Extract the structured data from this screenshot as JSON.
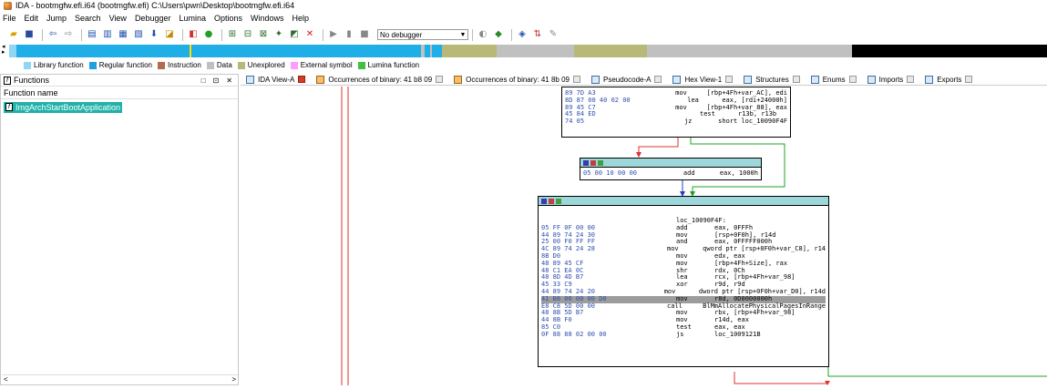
{
  "title": "IDA - bootmgfw.efi.i64 (bootmgfw.efi) C:\\Users\\pwn\\Desktop\\bootmgfw.efi.i64",
  "menu": [
    "File",
    "Edit",
    "Jump",
    "Search",
    "View",
    "Debugger",
    "Lumina",
    "Options",
    "Windows",
    "Help"
  ],
  "toolbar": {
    "debugger_select": "No debugger"
  },
  "legend": [
    {
      "label": "Library function",
      "color": "#8fd5f5"
    },
    {
      "label": "Regular function",
      "color": "#1fa0e0"
    },
    {
      "label": "Instruction",
      "color": "#b06c4c"
    },
    {
      "label": "Data",
      "color": "#c0c0c0"
    },
    {
      "label": "Unexplored",
      "color": "#b8b878"
    },
    {
      "label": "External symbol",
      "color": "#ff9cff"
    },
    {
      "label": "Lumina function",
      "color": "#40c040"
    }
  ],
  "functions_panel": {
    "title": "Functions",
    "column_header": "Function name",
    "items": [
      "ImgArchStartBootApplication"
    ]
  },
  "tabs": [
    {
      "label": "IDA View-A",
      "active": true
    },
    {
      "label": "Occurrences of binary: 41 b8 09",
      "active": false
    },
    {
      "label": "Occurrences of binary: 41 8b 09",
      "active": false
    },
    {
      "label": "Pseudocode-A",
      "active": false
    },
    {
      "label": "Hex View-1",
      "active": false
    },
    {
      "label": "Structures",
      "active": false
    },
    {
      "label": "Enums",
      "active": false
    },
    {
      "label": "Imports",
      "active": false
    },
    {
      "label": "Exports",
      "active": false
    }
  ],
  "graph": {
    "block1": {
      "lines": [
        {
          "b": "89 7D A3",
          "m": "mov",
          "o": "[rbp+4Fh+var_AC], edi"
        },
        {
          "b": "8D 87 00 40 02 00",
          "m": "lea",
          "o": "eax, [rdi+24000h]"
        },
        {
          "b": "89 45 C7",
          "m": "mov",
          "o": "[rbp+4Fh+var_88], eax"
        },
        {
          "b": "45 84 ED",
          "m": "test",
          "o": "r13b, r13b"
        },
        {
          "b": "74 05",
          "m": "jz",
          "o": "short loc_10090F4F"
        }
      ]
    },
    "block2": {
      "lines": [
        {
          "b": "05 00 10 00 00",
          "m": "add",
          "o": "eax, 1000h"
        }
      ]
    },
    "block3": {
      "label": "loc_10090F4F:",
      "lines": [
        {
          "b": "05 FF 0F 00 00",
          "m": "add",
          "o": "eax, 0FFFh"
        },
        {
          "b": "44 89 74 24 30",
          "m": "mov",
          "o": "[rsp+0F0h], r14d"
        },
        {
          "b": "25 00 F0 FF FF",
          "m": "and",
          "o": "eax, 0FFFFF000h"
        },
        {
          "b": "4C 89 74 24 28",
          "m": "mov",
          "o": "qword ptr [rsp+0F0h+var_C8], r14"
        },
        {
          "b": "8B D0",
          "m": "mov",
          "o": "edx, eax"
        },
        {
          "b": "48 89 45 CF",
          "m": "mov",
          "o": "[rbp+4Fh+Size], rax"
        },
        {
          "b": "48 C1 EA 0C",
          "m": "shr",
          "o": "rdx, 0Ch"
        },
        {
          "b": "48 8D 4D B7",
          "m": "lea",
          "o": "rcx, [rbp+4Fh+var_98]"
        },
        {
          "b": "45 33 C9",
          "m": "xor",
          "o": "r9d, r9d"
        },
        {
          "b": "44 89 74 24 20",
          "m": "mov",
          "o": "dword ptr [rsp+0F0h+var_D0], r14d"
        },
        {
          "b": "41 B8 00 00 00 D0",
          "m": "mov",
          "o": "r8d, 0D0000000h",
          "hl": true
        },
        {
          "b": "E8 C8 5D 00 00",
          "m": "call",
          "o": "BlMmAllocatePhysicalPagesInRange"
        },
        {
          "b": "48 8B 5D B7",
          "m": "mov",
          "o": "rbx, [rbp+4Fh+var_98]"
        },
        {
          "b": "44 8B F0",
          "m": "mov",
          "o": "r14d, eax"
        },
        {
          "b": "85 C0",
          "m": "test",
          "o": "eax, eax"
        },
        {
          "b": "0F 88 88 02 00 00",
          "m": "js",
          "o": "loc_1009121B"
        }
      ]
    }
  }
}
